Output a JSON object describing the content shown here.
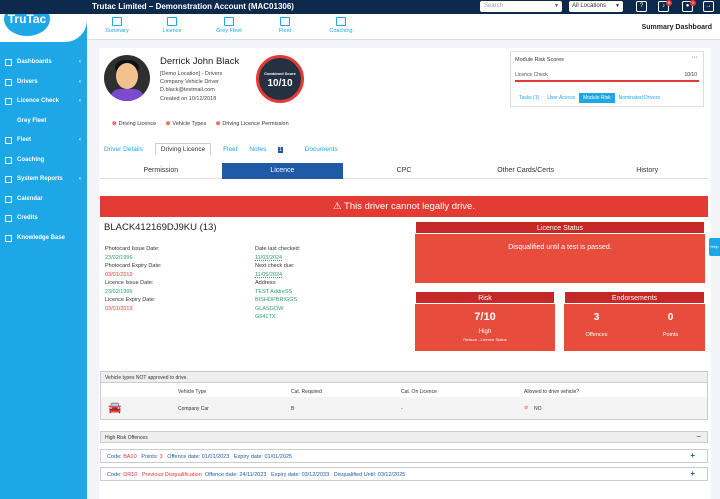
{
  "topbar": {
    "account": "Trutac Limited – Demonstration Account  (MAC01306)",
    "search_placeholder": "Search",
    "location": "All Locations",
    "icons": [
      "help-icon",
      "bell-icon",
      "user-icon",
      "logout-icon"
    ],
    "badges": [
      "9",
      "1"
    ]
  },
  "logo": {
    "text": "TruTac"
  },
  "sidebar": {
    "items": [
      {
        "label": "Dashboards",
        "chevron": "‹"
      },
      {
        "label": "Drivers",
        "chevron": "‹"
      },
      {
        "label": "Licence Check",
        "chevron": "‹"
      },
      {
        "label": "Grey Fleet",
        "chevron": ""
      },
      {
        "label": "Fleet",
        "chevron": "‹"
      },
      {
        "label": "Coaching",
        "chevron": ""
      },
      {
        "label": "System Reports",
        "chevron": "‹"
      },
      {
        "label": "Calendar",
        "chevron": ""
      },
      {
        "label": "Credits",
        "chevron": ""
      },
      {
        "label": "Knowledge Base",
        "chevron": ""
      }
    ]
  },
  "top_tabs": {
    "items": [
      "Summary",
      "Licence",
      "Grey Fleet",
      "Fleet",
      "Coaching"
    ],
    "page_title": "Summary Dashboard"
  },
  "profile": {
    "name": "Derrick John Black",
    "lines": [
      "[Demo Location] - Drivers",
      "Company Vehicle Driver",
      "D.black@testmail.com",
      "Created on 10/12/2018"
    ],
    "score_label": "Combined Score",
    "score_value": "10/10"
  },
  "module_risk": {
    "title": "Module Risk Scores",
    "dots": "···",
    "row_label": "Licence Check",
    "row_value": "10/10",
    "tabs": [
      "Tasks (1)",
      "User Access",
      "Module Risk",
      "Nominated Drivers"
    ]
  },
  "licence_types": [
    "Driving Licence",
    "Vehicle Types",
    "Driving Licence Permission"
  ],
  "sub_tabs": [
    "Driver Details",
    "Driving Licence",
    "Fleet",
    "Notes",
    "Documents"
  ],
  "notes_count": "1",
  "section_tabs": [
    "Permission",
    "Licence",
    "CPC",
    "Other Cards/Certs",
    "History"
  ],
  "alert": "⚠ This driver cannot legally drive.",
  "licence": {
    "number": "BLACK412169DJ9KU (13)",
    "photocard_issue_label": "Photocard Issue Date:",
    "photocard_issue": "23/02/1996",
    "photocard_expiry_label": "Photocard Expiry Date:",
    "photocard_expiry": "03/01/2019",
    "licence_issue_label": "Licence Issue Date:",
    "licence_issue": "23/02/1996",
    "licence_expiry_label": "Licence Expiry Date:",
    "licence_expiry": "03/01/2019",
    "last_checked_label": "Date last checked:",
    "last_checked": "11/03/2024",
    "next_check_label": "Next check due:",
    "next_check": "11/05/2024",
    "address_label": "Address:",
    "address": [
      "TEST AddreSS",
      "BISHOPBRIGGS",
      "GLASGOW",
      "G641TX"
    ]
  },
  "licence_status": {
    "title": "Licence Status",
    "text": "Disqualified until a test is passed."
  },
  "risk": {
    "title": "Risk",
    "value": "7/10",
    "level": "High",
    "reason": "Reason - Licence Status"
  },
  "endorsements": {
    "title": "Endorsements",
    "offences": "3",
    "offences_label": "Offences",
    "points": "0",
    "points_label": "Points"
  },
  "vehicle_types": {
    "title": "Vehicle types NOT approved to drive.",
    "headers": [
      "Vehicle Type",
      "Cat. Required",
      "Cat. On Licence",
      "Allowed to drive vehicle?"
    ],
    "row": [
      "Company Car",
      "B",
      "-",
      "NO"
    ]
  },
  "high_risk": {
    "title": "High Risk Offences",
    "toggle": "−",
    "rows": [
      {
        "code_label": "Code:",
        "code": "BA10",
        "a_label": "Points:",
        "a": "3",
        "b_label": "Offence date:",
        "b": "01/01/2023",
        "c_label": "Expiry date:",
        "c": "01/01/2025",
        "d_label": "",
        "d": ""
      },
      {
        "code_label": "Code:",
        "code": "DR10",
        "a_label": "",
        "a": "Previous Disqualification",
        "b_label": "Offence date:",
        "b": "24/11/2023",
        "c_label": "Expiry date:",
        "c": "03/12/2033",
        "d_label": "Disqualified Until:",
        "d": "03/12/2025"
      }
    ]
  },
  "colors": {
    "sidebar": "#1ea7e6",
    "topbar": "#0d2a4d",
    "accent": "#1e5aa8",
    "danger": "#e53935",
    "good": "#27a06f"
  }
}
